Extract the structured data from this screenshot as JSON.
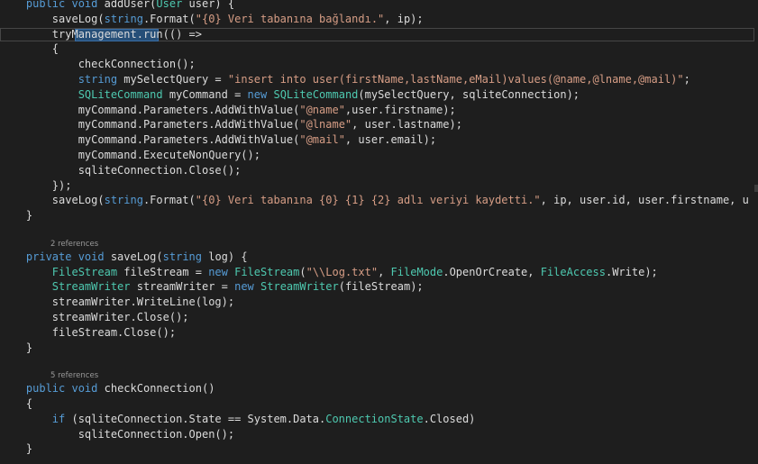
{
  "colors": {
    "background": "#1e1e1e",
    "text": "#dcdcdc",
    "keyword": "#569cd6",
    "type": "#4ec9b0",
    "string": "#d69d85",
    "reference": "#999999",
    "selection": "#264f78"
  },
  "code_lines": [
    [
      [
        "    public void ",
        "k"
      ],
      [
        "addUser(",
        "d"
      ],
      [
        "User",
        "t"
      ],
      [
        " user) {",
        "d"
      ]
    ],
    [
      [
        "        saveLog(",
        "d"
      ],
      [
        "string",
        "k"
      ],
      [
        ".Format(",
        "d"
      ],
      [
        "\"{0} Veri tabanına bağlandı.\"",
        "s"
      ],
      [
        ", ip);",
        "d"
      ]
    ],
    [
      [
        "        tryManagement",
        "d"
      ],
      [
        ".run(() =>",
        "d"
      ]
    ],
    [
      [
        "        {",
        "d"
      ]
    ],
    [
      [
        "            checkConnection();",
        "d"
      ]
    ],
    [
      [
        "            ",
        "d"
      ],
      [
        "string",
        "k"
      ],
      [
        " mySelectQuery = ",
        "d"
      ],
      [
        "\"insert into user(firstName,lastName,eMail)values(@name,@lname,@mail)\"",
        "s"
      ],
      [
        ";",
        "d"
      ]
    ],
    [
      [
        "            ",
        "d"
      ],
      [
        "SQLiteCommand",
        "t"
      ],
      [
        " myCommand = ",
        "d"
      ],
      [
        "new",
        "k"
      ],
      [
        " ",
        "d"
      ],
      [
        "SQLiteCommand",
        "t"
      ],
      [
        "(mySelectQuery, sqliteConnection);",
        "d"
      ]
    ],
    [
      [
        "            myCommand.Parameters.AddWithValue(",
        "d"
      ],
      [
        "\"@name\"",
        "s"
      ],
      [
        ",user.firstname);",
        "d"
      ]
    ],
    [
      [
        "            myCommand.Parameters.AddWithValue(",
        "d"
      ],
      [
        "\"@lname\"",
        "s"
      ],
      [
        ", user.lastname);",
        "d"
      ]
    ],
    [
      [
        "            myCommand.Parameters.AddWithValue(",
        "d"
      ],
      [
        "\"@mail\"",
        "s"
      ],
      [
        ", user.email);",
        "d"
      ]
    ],
    [
      [
        "            myCommand.ExecuteNonQuery();",
        "d"
      ]
    ],
    [
      [
        "            sqliteConnection.Close();",
        "d"
      ]
    ],
    [
      [
        "        });",
        "d"
      ]
    ],
    [
      [
        "        saveLog(",
        "d"
      ],
      [
        "string",
        "k"
      ],
      [
        ".Format(",
        "d"
      ],
      [
        "\"{0} Veri tabanına {0} {1} {2} adlı veriyi kaydetti.\"",
        "s"
      ],
      [
        ", ip, user.id, user.firstname, u",
        "d"
      ]
    ],
    [
      [
        "    }",
        "d"
      ]
    ],
    [
      [
        "",
        "d"
      ]
    ],
    [
      [
        "    ",
        "d"
      ],
      [
        "private void",
        "k"
      ],
      [
        " saveLog(",
        "d"
      ],
      [
        "string",
        "k"
      ],
      [
        " log) {",
        "d"
      ]
    ],
    [
      [
        "        ",
        "d"
      ],
      [
        "FileStream",
        "t"
      ],
      [
        " fileStream = ",
        "d"
      ],
      [
        "new",
        "k"
      ],
      [
        " ",
        "d"
      ],
      [
        "FileStream",
        "t"
      ],
      [
        "(",
        "d"
      ],
      [
        "\"\\\\Log.txt\"",
        "s"
      ],
      [
        ", ",
        "d"
      ],
      [
        "FileMode",
        "t"
      ],
      [
        ".OpenOrCreate, ",
        "d"
      ],
      [
        "FileAccess",
        "t"
      ],
      [
        ".Write);",
        "d"
      ]
    ],
    [
      [
        "        ",
        "d"
      ],
      [
        "StreamWriter",
        "t"
      ],
      [
        " streamWriter = ",
        "d"
      ],
      [
        "new",
        "k"
      ],
      [
        " ",
        "d"
      ],
      [
        "StreamWriter",
        "t"
      ],
      [
        "(fileStream);",
        "d"
      ]
    ],
    [
      [
        "        streamWriter.WriteLine(log);",
        "d"
      ]
    ],
    [
      [
        "        streamWriter.Close();",
        "d"
      ]
    ],
    [
      [
        "        fileStream.Close();",
        "d"
      ]
    ],
    [
      [
        "    }",
        "d"
      ]
    ],
    [
      [
        "",
        "d"
      ]
    ],
    [
      [
        "    ",
        "d"
      ],
      [
        "public void",
        "k"
      ],
      [
        " checkConnection()",
        "d"
      ]
    ],
    [
      [
        "    {",
        "d"
      ]
    ],
    [
      [
        "        ",
        "d"
      ],
      [
        "if",
        "k"
      ],
      [
        " (sqliteConnection.State == System.Data.",
        "d"
      ],
      [
        "ConnectionState",
        "t"
      ],
      [
        ".Closed)",
        "d"
      ]
    ],
    [
      [
        "            sqliteConnection.Open();",
        "d"
      ]
    ],
    [
      [
        "    }",
        "d"
      ]
    ]
  ],
  "references": [
    {
      "after_line": 15,
      "text": "2 references"
    },
    {
      "after_line": 23,
      "text": "5 references"
    }
  ]
}
